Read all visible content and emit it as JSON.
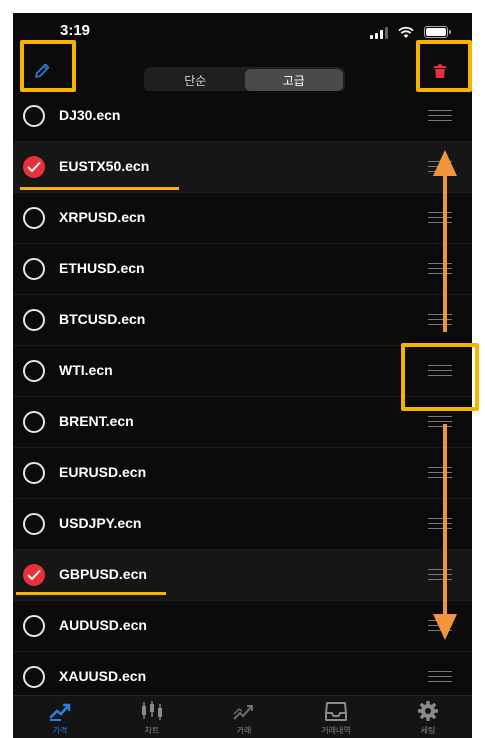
{
  "status": {
    "time": "3:19"
  },
  "nav": {
    "segments": [
      {
        "label": "단순",
        "active": false
      },
      {
        "label": "고급",
        "active": true
      }
    ]
  },
  "symbols": [
    {
      "name": "DJ30.ecn",
      "checked": false
    },
    {
      "name": "EUSTX50.ecn",
      "checked": true
    },
    {
      "name": "XRPUSD.ecn",
      "checked": false
    },
    {
      "name": "ETHUSD.ecn",
      "checked": false
    },
    {
      "name": "BTCUSD.ecn",
      "checked": false
    },
    {
      "name": "WTI.ecn",
      "checked": false
    },
    {
      "name": "BRENT.ecn",
      "checked": false
    },
    {
      "name": "EURUSD.ecn",
      "checked": false
    },
    {
      "name": "USDJPY.ecn",
      "checked": false
    },
    {
      "name": "GBPUSD.ecn",
      "checked": true
    },
    {
      "name": "AUDUSD.ecn",
      "checked": false
    },
    {
      "name": "XAUUSD.ecn",
      "checked": false
    }
  ],
  "tabs": [
    {
      "label": "가격",
      "icon": "price-icon",
      "active": true
    },
    {
      "label": "차트",
      "icon": "candlestick-icon",
      "active": false
    },
    {
      "label": "거래",
      "icon": "trade-icon",
      "active": false
    },
    {
      "label": "거래내역",
      "icon": "history-tray-icon",
      "active": false
    },
    {
      "label": "세팅",
      "icon": "gear-icon",
      "active": false
    }
  ],
  "colors": {
    "background": "#0b0b0b",
    "check_red": "#e8303a",
    "accent_blue": "#2f7de1",
    "highlight": "#f5b400",
    "arrow": "#f0953a"
  }
}
